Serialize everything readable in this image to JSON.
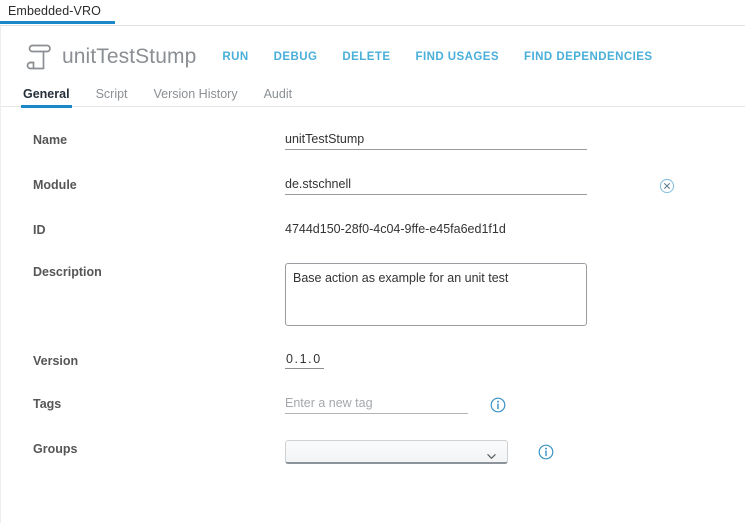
{
  "app_tab": {
    "label": "Embedded-VRO",
    "accent_color": "#1a87c8"
  },
  "header": {
    "icon": "scroll-icon",
    "title": "unitTestStump",
    "actions": [
      {
        "label": "RUN",
        "name": "run-action"
      },
      {
        "label": "DEBUG",
        "name": "debug-action"
      },
      {
        "label": "DELETE",
        "name": "delete-action"
      },
      {
        "label": "FIND USAGES",
        "name": "find-usages-action"
      },
      {
        "label": "FIND DEPENDENCIES",
        "name": "find-dependencies-action"
      }
    ],
    "action_color": "#49afd9"
  },
  "tabs": [
    {
      "label": "General",
      "active": true
    },
    {
      "label": "Script",
      "active": false
    },
    {
      "label": "Version History",
      "active": false
    },
    {
      "label": "Audit",
      "active": false
    }
  ],
  "form": {
    "name": {
      "label": "Name",
      "value": "unitTestStump",
      "placeholder": ""
    },
    "module": {
      "label": "Module",
      "value": "de.stschnell",
      "placeholder": "",
      "clear_icon": "clear-circle-icon"
    },
    "id": {
      "label": "ID",
      "value": "4744d150-28f0-4c04-9ffe-e45fa6ed1f1d"
    },
    "description": {
      "label": "Description",
      "value": "Base action as example for an unit test",
      "placeholder": ""
    },
    "version": {
      "label": "Version",
      "value": "0.1.0"
    },
    "tags": {
      "label": "Tags",
      "value": "",
      "placeholder": "Enter a new tag",
      "info_icon": "info-circle-icon"
    },
    "groups": {
      "label": "Groups",
      "value": "",
      "info_icon": "info-circle-icon",
      "chevron_icon": "chevron-down-icon"
    }
  }
}
